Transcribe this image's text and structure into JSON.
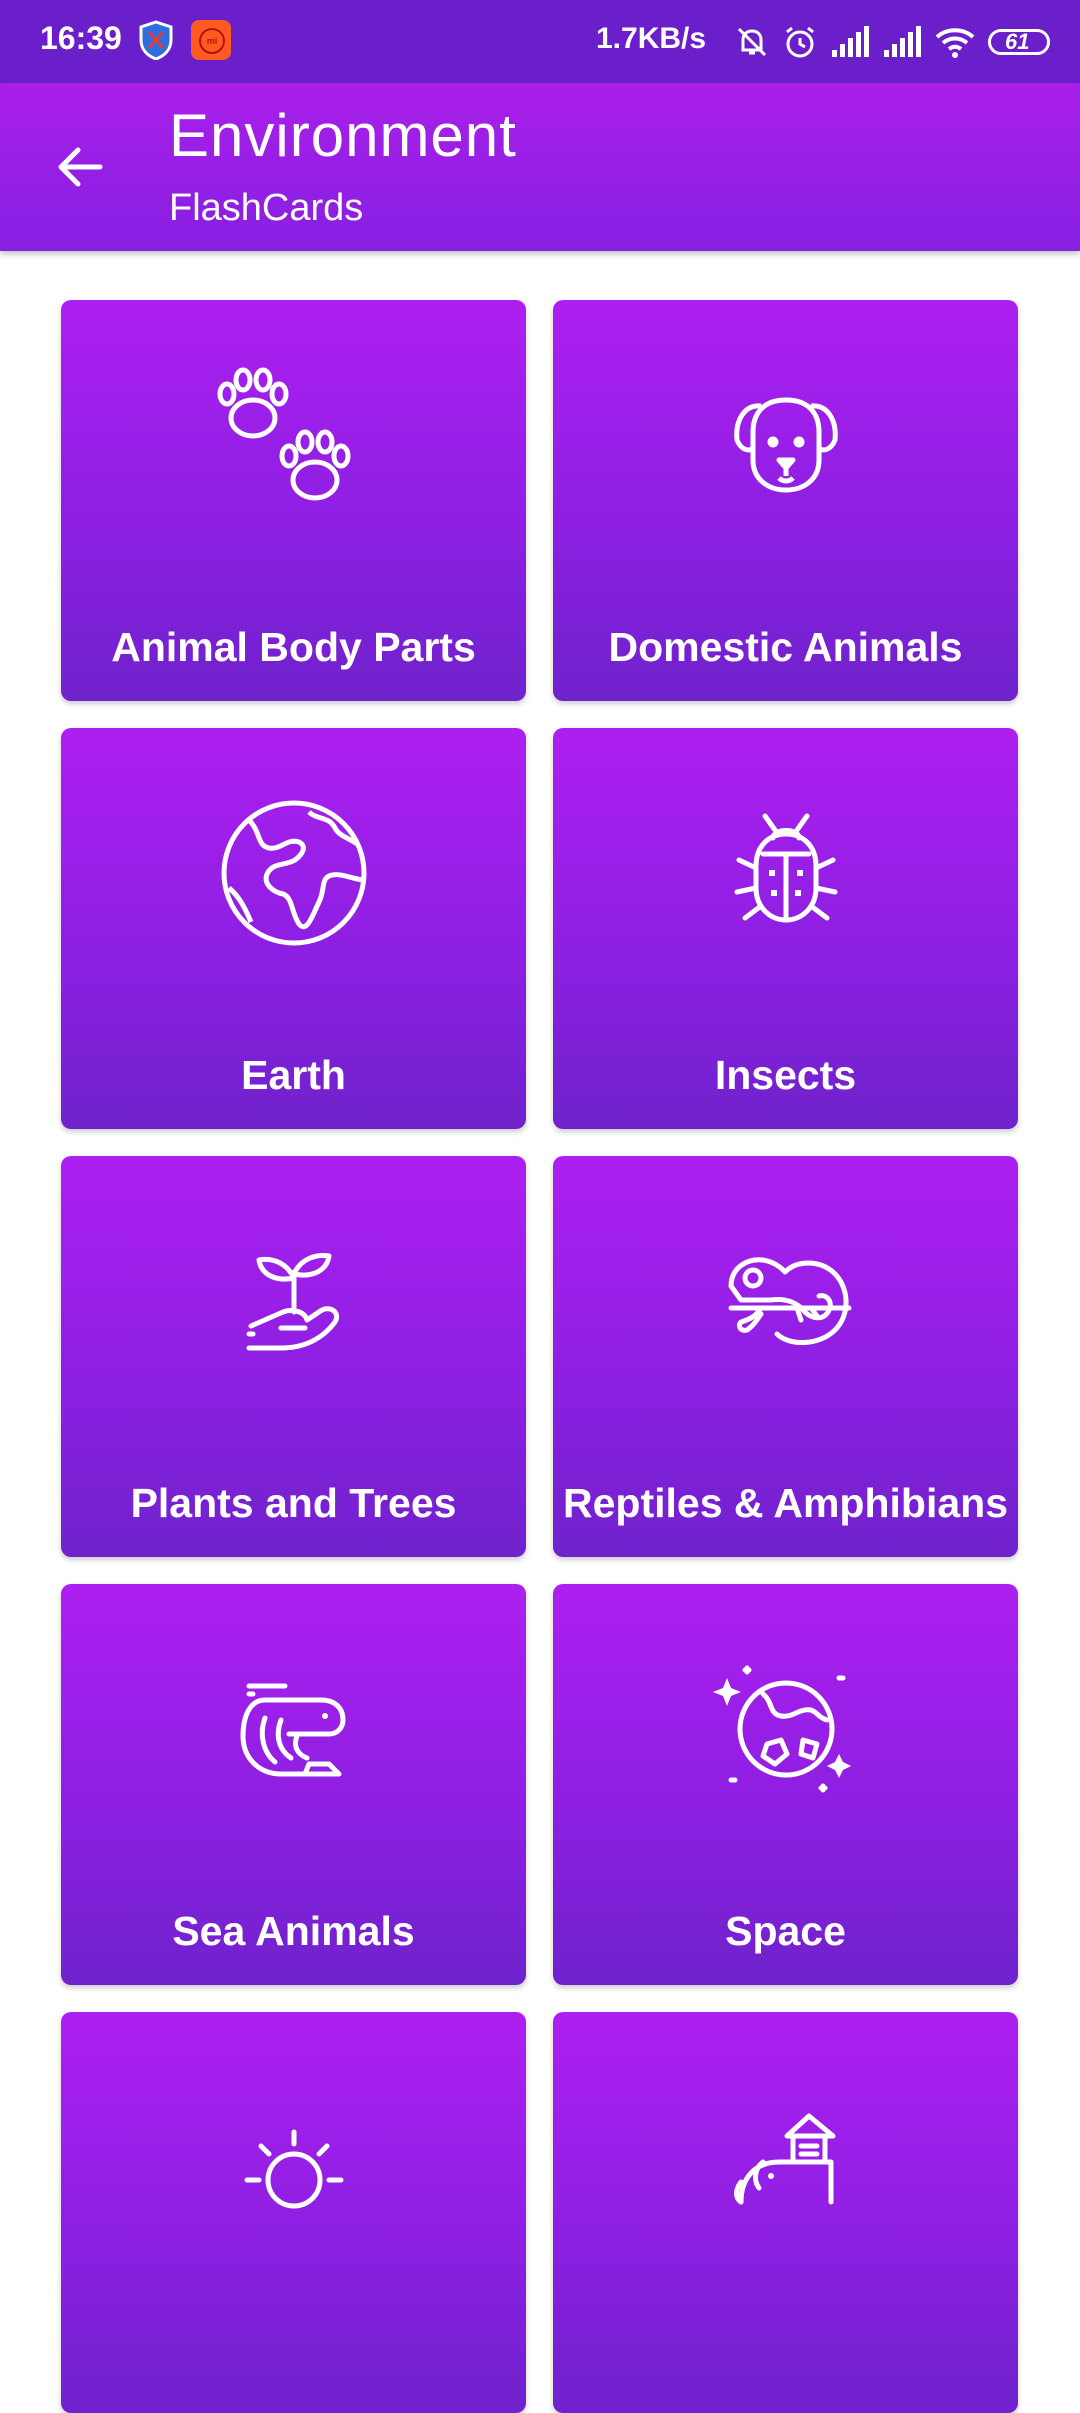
{
  "status_bar": {
    "time": "16:39",
    "net_speed": "1.7KB/s",
    "battery": "61",
    "icons": [
      "shield-icon",
      "mi-icon",
      "bell-off-icon",
      "alarm-icon",
      "signal-icon",
      "signal-icon",
      "wifi-icon",
      "battery-icon"
    ]
  },
  "app_bar": {
    "title": "Environment",
    "subtitle": "FlashCards",
    "back_icon": "arrow-left-icon"
  },
  "cards": [
    {
      "label": "Animal Body Parts",
      "icon": "paw-prints-icon"
    },
    {
      "label": "Domestic Animals",
      "icon": "dog-icon"
    },
    {
      "label": "Earth",
      "icon": "globe-icon"
    },
    {
      "label": "Insects",
      "icon": "ladybug-icon"
    },
    {
      "label": "Plants and Trees",
      "icon": "sprout-hand-icon"
    },
    {
      "label": "Reptiles & Amphibians",
      "icon": "chameleon-icon"
    },
    {
      "label": "Sea Animals",
      "icon": "shrimp-icon"
    },
    {
      "label": "Space",
      "icon": "planet-icon"
    },
    {
      "label": "",
      "icon": "sun-icon"
    },
    {
      "label": "",
      "icon": "elephant-icon"
    }
  ],
  "colors": {
    "status_bar": "#6a1fcb",
    "app_bar_top": "#aa1fe9",
    "card_top": "#ad1ff0",
    "card_bottom": "#6f22cc"
  }
}
